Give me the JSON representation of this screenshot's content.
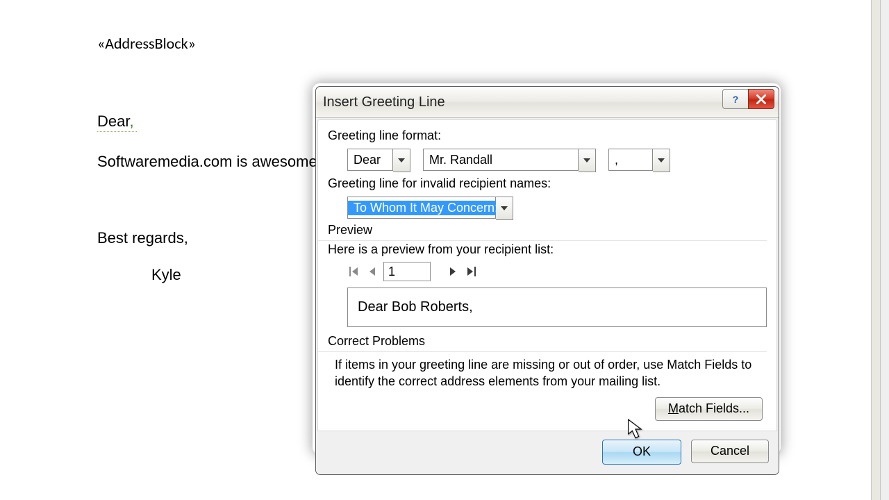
{
  "doc": {
    "address_block": "«AddressBlock»",
    "dear": "Dear",
    "dear_punct": ",",
    "body": "Softwaremedia.com is awesome.",
    "regards": "Best regards,",
    "name": "Kyle"
  },
  "dialog": {
    "title": "Insert Greeting Line",
    "format_label": "Greeting line format:",
    "salutation": "Dear",
    "name_format": "Mr. Randall",
    "punct": ",",
    "invalid_label": "Greeting line for invalid recipient names:",
    "invalid_value": "To Whom It May Concern:",
    "preview_label": "Preview",
    "preview_desc": "Here is a preview from your recipient list:",
    "record_number": "1",
    "preview_text": "Dear Bob Roberts,",
    "correct_label": "Correct Problems",
    "correct_text": "If items in your greeting line are missing or out of order, use Match Fields to identify the correct address elements from your mailing list.",
    "match_fields": "Match Fields...",
    "ok": "OK",
    "cancel": "Cancel"
  }
}
